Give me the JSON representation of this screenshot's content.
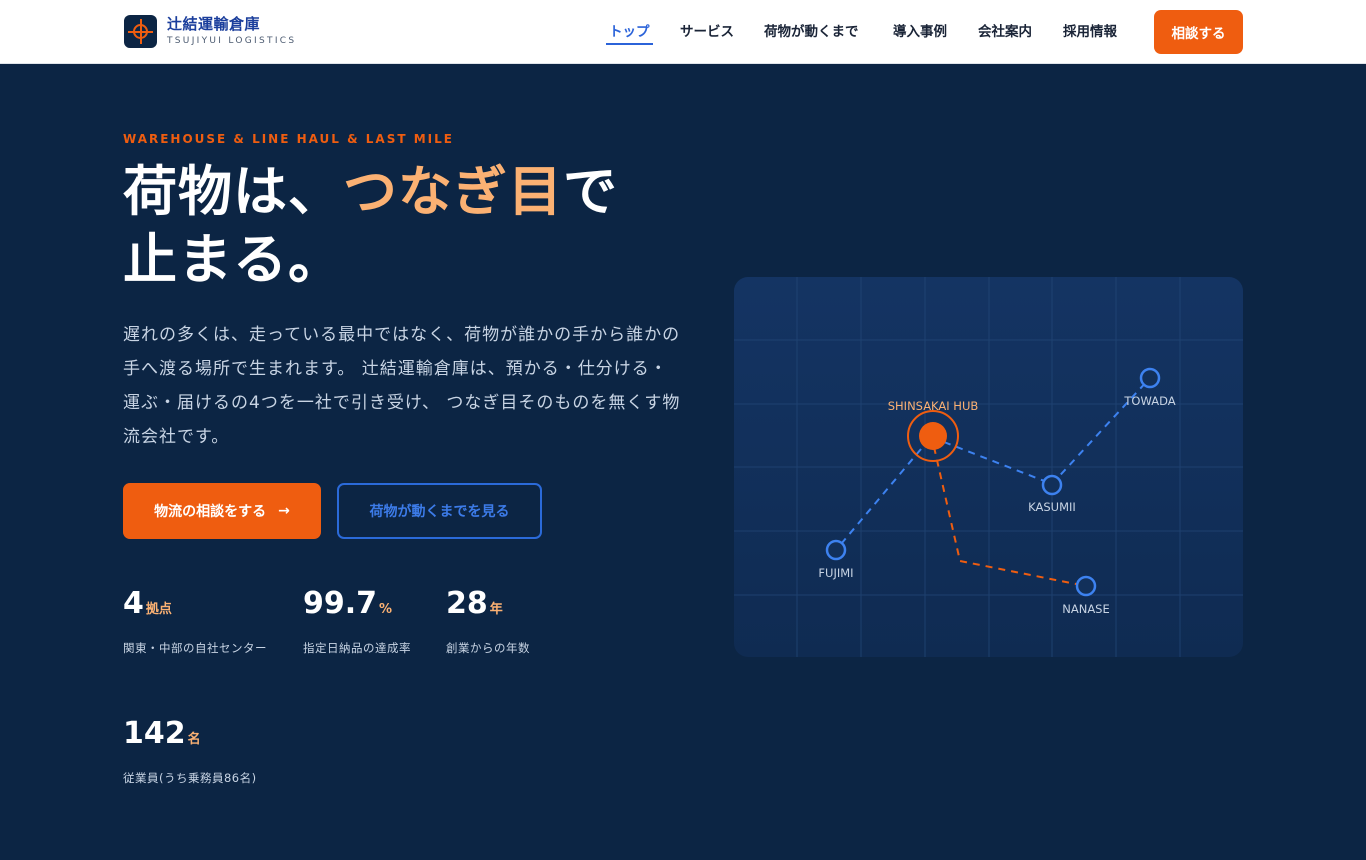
{
  "brand": {
    "name": "辻結運輸倉庫",
    "sub": "TSUJIYUI LOGISTICS"
  },
  "nav": {
    "items": [
      {
        "label": "トップ",
        "active": true
      },
      {
        "label": "サービス",
        "active": false
      },
      {
        "label": "荷物が動くまで",
        "active": false
      },
      {
        "label": "導入事例",
        "active": false
      },
      {
        "label": "会社案内",
        "active": false
      },
      {
        "label": "採用情報",
        "active": false
      }
    ],
    "cta": "相談する"
  },
  "hero": {
    "eyebrow": "WAREHOUSE & LINE HAUL & LAST MILE",
    "headline_pre": "荷物は、",
    "headline_accent": "つなぎ目",
    "headline_post": "で",
    "headline_line2": "止まる。",
    "lead": "遅れの多くは、走っている最中ではなく、荷物が誰かの手から誰かの手へ渡る場所で生まれます。 辻結運輸倉庫は、預かる・仕分ける・運ぶ・届けるの4つを一社で引き受け、 つなぎ目そのものを無くす物流会社です。",
    "primary_button": "物流の相談をする",
    "primary_arrow": "→",
    "secondary_button": "荷物が動くまでを見る"
  },
  "stats": [
    {
      "value": "4",
      "unit": "拠点",
      "label": "関東・中部の自社センター"
    },
    {
      "value": "99.7",
      "unit": "%",
      "label": "指定日納品の達成率"
    },
    {
      "value": "28",
      "unit": "年",
      "label": "創業からの年数"
    },
    {
      "value": "142",
      "unit": "名",
      "label": "従業員(うち乗務員86名)"
    }
  ],
  "map": {
    "hub": "SHINSAKAI HUB",
    "nodes": [
      "TOWADA",
      "KASUMII",
      "FUJIMI",
      "NANASE"
    ]
  },
  "colors": {
    "accent": "#ef5d10",
    "accent_light": "#fbb173",
    "blue": "#2b6ad9",
    "navy": "#0c2544"
  }
}
